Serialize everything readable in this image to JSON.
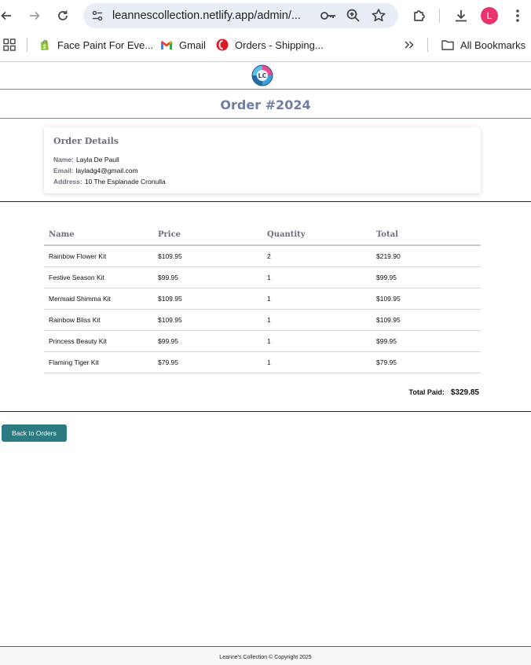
{
  "browser": {
    "url": "leannescollection.netlify.app/admin/...",
    "avatar_letter": "L",
    "bookmarks": [
      {
        "label": "Face Paint For Eve...",
        "icon": "shopify-icon"
      },
      {
        "label": "Gmail",
        "icon": "gmail-icon"
      },
      {
        "label": "Orders - Shipping...",
        "icon": "australia-post-icon"
      }
    ],
    "all_bookmarks_label": "All Bookmarks",
    "colors": {
      "omnibox": "#e9eef6",
      "avatar": "#e8336d"
    }
  },
  "page": {
    "logo_text": "LC",
    "order_title": "Order #2024",
    "details": {
      "heading": "Order Details",
      "name_label": "Name:",
      "name": "Layla De Paull",
      "email_label": "Email:",
      "email": "layladg4@gmail.com",
      "address_label": "Address:",
      "address": "10 The Esplanade Cronulla"
    },
    "table": {
      "headers": [
        "Name",
        "Price",
        "Quantity",
        "Total"
      ],
      "rows": [
        [
          "Rainbow Flower Kit",
          "$109.95",
          "2",
          "$219.90"
        ],
        [
          "Festive Season Kit",
          "$99.95",
          "1",
          "$99.95"
        ],
        [
          "Mermaid Shimma Kit",
          "$109.95",
          "1",
          "$109.95"
        ],
        [
          "Rainbow Bliss Kit",
          "$109.95",
          "1",
          "$109.95"
        ],
        [
          "Princess Beauty Kit",
          "$99.95",
          "1",
          "$99.95"
        ],
        [
          "Flaming Tiger Kit",
          "$79.95",
          "1",
          "$79.95"
        ]
      ]
    },
    "total_label": "Total Paid:",
    "total_value": "$329.85",
    "back_button": "Back to Orders",
    "footer": "Leanne's Collection © Copyright 2025",
    "colors": {
      "title": "#6f7da6",
      "button": "#2c7a82",
      "label": "#6b6f7d"
    }
  }
}
